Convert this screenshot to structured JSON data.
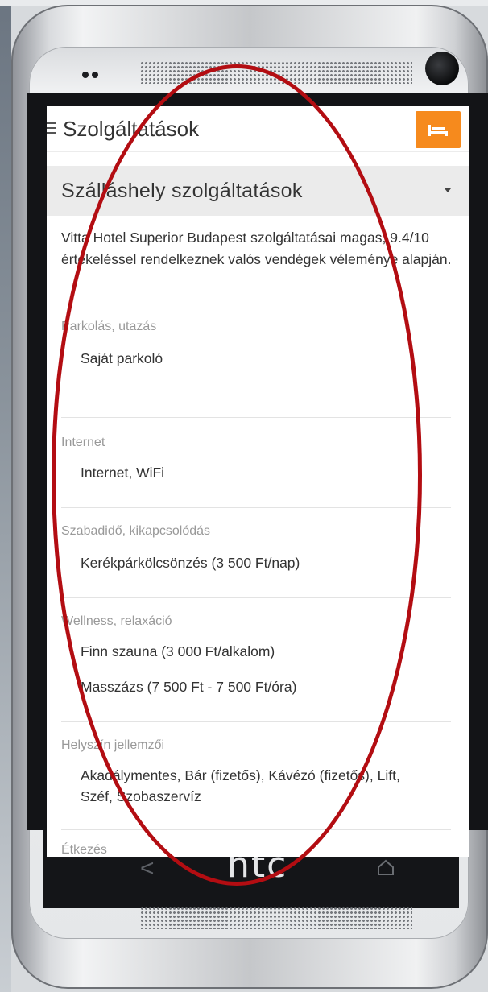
{
  "header": {
    "title": "Szolgáltatások"
  },
  "section": {
    "title": "Szálláshely szolgáltatások"
  },
  "intro": "Vitta Hotel Superior Budapest szolgáltatásai magas, 9.4/10 értékeléssel rendelkeznek valós vendégek véleménye alapján.",
  "categories": [
    {
      "name": "Parkolás, utazás",
      "items": [
        "Saját parkoló"
      ]
    },
    {
      "name": "Internet",
      "items": [
        "Internet, WiFi"
      ]
    },
    {
      "name": "Szabadidő, kikapcsolódás",
      "items": [
        "Kerékpárkölcsönzés (3 500 Ft/nap)"
      ]
    },
    {
      "name": "Wellness, relaxáció",
      "items": [
        "Finn szauna (3 000 Ft/alkalom)",
        "Masszázs (7 500 Ft - 7 500 Ft/óra)"
      ]
    },
    {
      "name": "Helyszín jellemzői",
      "items": [
        "Akadálymentes, Bár (fizetős), Kávézó (fizetős), Lift, Széf, Szobaszervíz"
      ]
    },
    {
      "name": "Étkezés",
      "items": []
    }
  ],
  "device": {
    "brand": "htc"
  },
  "colors": {
    "accent": "#f68a1d",
    "annotation": "#b30d12"
  },
  "icons": [
    "menu-icon",
    "bed-icon",
    "caret-down-icon",
    "back-icon",
    "home-icon"
  ]
}
